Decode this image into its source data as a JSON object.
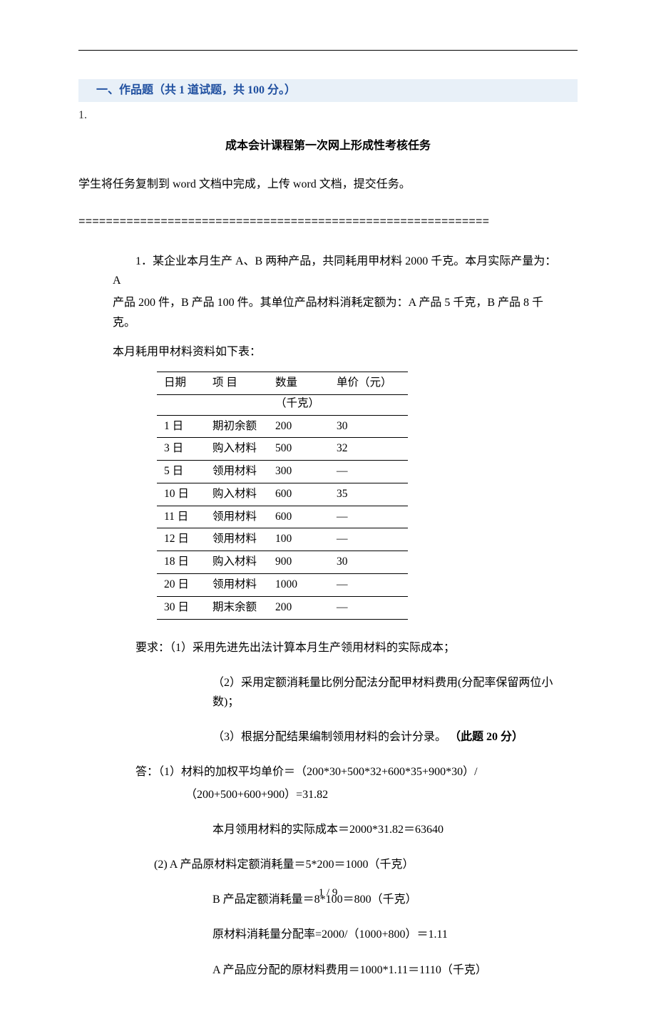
{
  "section_header": "一、作品题（共  1  道试题，共  100  分。）",
  "question_number": "1.",
  "doc_title": "成本会计课程第一次网上形成性考核任务",
  "instruction": "学生将任务复制到 word 文档中完成，上传 word 文档，提交任务。",
  "divider": "============================================================",
  "problem": {
    "line1": "1．某企业本月生产 A、B 两种产品，共同耗用甲材料 2000 千克。本月实际产量为：A",
    "line2": "产品 200 件，B 产品 100 件。其单位产品材料消耗定额为：A 产品 5 千克，B 产品 8 千克。",
    "line3": "本月耗用甲材料资料如下表："
  },
  "table": {
    "headers": {
      "date": "日期",
      "item": "项 目",
      "qty": "数量",
      "price": "单价（元）"
    },
    "qty_sub": "（千克）",
    "rows": [
      {
        "date": "1 日",
        "item": "期初余额",
        "qty": "200",
        "price": "30"
      },
      {
        "date": "3 日",
        "item": "购入材料",
        "qty": "500",
        "price": "32"
      },
      {
        "date": "5 日",
        "item": "领用材料",
        "qty": "300",
        "price": "—"
      },
      {
        "date": "10 日",
        "item": "购入材料",
        "qty": "600",
        "price": "35"
      },
      {
        "date": "11 日",
        "item": "领用材料",
        "qty": "600",
        "price": "—"
      },
      {
        "date": "12 日",
        "item": "领用材料",
        "qty": "100",
        "price": "—"
      },
      {
        "date": "18 日",
        "item": "购入材料",
        "qty": "900",
        "price": "30"
      },
      {
        "date": "20 日",
        "item": "领用材料",
        "qty": "1000",
        "price": "—"
      },
      {
        "date": "30 日",
        "item": "期末余额",
        "qty": "200",
        "price": "—"
      }
    ]
  },
  "requirements": {
    "r1": "要求：（1）采用先进先出法计算本月生产领用材料的实际成本；",
    "r2": "（2）采用定额消耗量比例分配法分配甲材料费用(分配率保留两位小数)；",
    "r3_pre": "（3）根据分配结果编制领用材料的会计分录。 ",
    "r3_bold": "（此题 20 分）"
  },
  "answer": {
    "a1": "答：（1）材料的加权平均单价＝（200*30+500*32+600*35+900*30）/",
    "a1b": "（200+500+600+900）=31.82",
    "a2": "本月领用材料的实际成本＝2000*31.82＝63640",
    "a3": "(2) A 产品原材料定额消耗量＝5*200＝1000（千克）",
    "a4": "B 产品定额消耗量＝8*100＝800（千克）",
    "a5": "原材料消耗量分配率=2000/（1000+800）＝1.11",
    "a6": "A 产品应分配的原材料费用＝1000*1.11＝1110（千克）"
  },
  "footer": "1 / 9"
}
